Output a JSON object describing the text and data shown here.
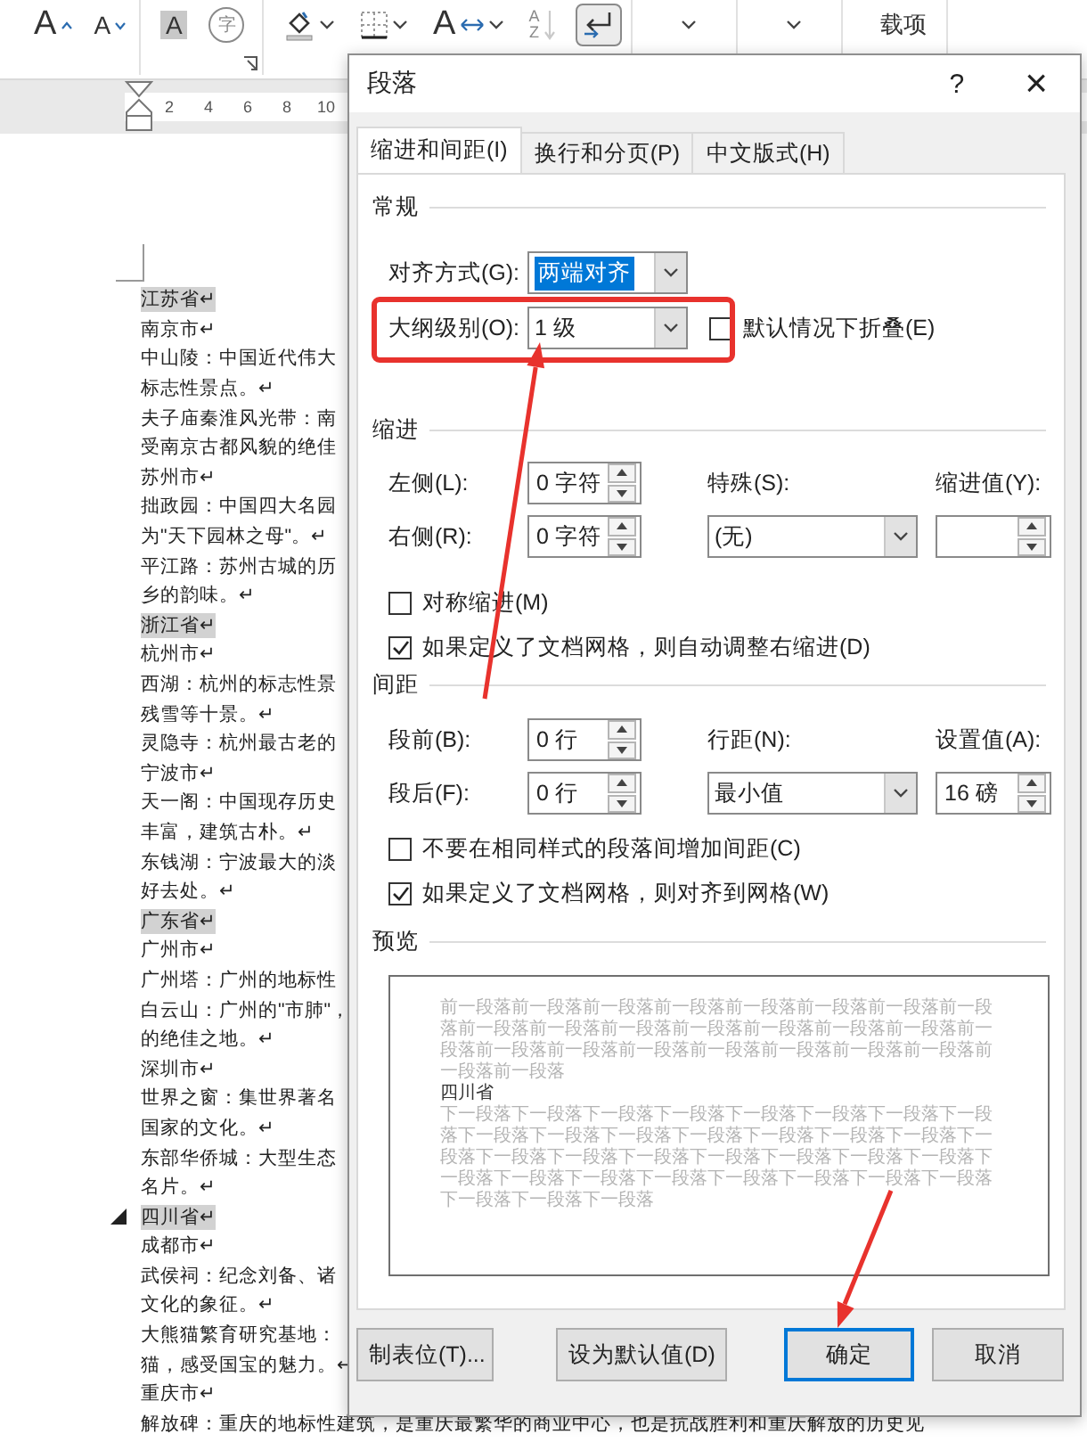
{
  "ribbon": {
    "groups": [
      [
        {
          "kind": "grow-font",
          "glyph": "A",
          "pressed": false,
          "disabled": false
        },
        {
          "kind": "shrink-font",
          "glyph": "A",
          "pressed": false,
          "disabled": false
        }
      ],
      [
        {
          "kind": "char-shading",
          "glyph": "A",
          "pressed": false,
          "disabled": false
        },
        {
          "kind": "enclose",
          "glyph": "字",
          "pressed": false,
          "disabled": true
        }
      ],
      [
        {
          "kind": "shading",
          "pressed": false,
          "disabled": false
        },
        {
          "kind": "borders",
          "pressed": false,
          "disabled": false
        },
        {
          "kind": "asian-layout",
          "glyph": "A",
          "pressed": false,
          "disabled": false
        },
        {
          "kind": "sort",
          "glyphs": [
            "A",
            "Z"
          ],
          "pressed": false,
          "disabled": true
        },
        {
          "kind": "show-marks",
          "pressed": true,
          "disabled": false
        }
      ],
      [
        {
          "kind": "dropdown",
          "pressed": false,
          "disabled": false
        }
      ],
      [
        {
          "kind": "dropdown",
          "pressed": false,
          "disabled": false
        }
      ],
      [
        {
          "kind": "label",
          "label": "载项",
          "pressed": false,
          "disabled": false
        }
      ]
    ]
  },
  "ruler": {
    "ticks": [
      "2",
      "4",
      "6",
      "8",
      "10"
    ]
  },
  "document": {
    "lines": [
      {
        "text": "江苏省↵",
        "heading": true,
        "toggle": false
      },
      {
        "text": "南京市↵",
        "heading": false,
        "toggle": false
      },
      {
        "text": "中山陵：中国近代伟大",
        "heading": false,
        "toggle": false
      },
      {
        "text": "标志性景点。↵",
        "heading": false,
        "toggle": false
      },
      {
        "text": "夫子庙秦淮风光带：南",
        "heading": false,
        "toggle": false
      },
      {
        "text": "受南京古都风貌的绝佳",
        "heading": false,
        "toggle": false
      },
      {
        "text": "苏州市↵",
        "heading": false,
        "toggle": false
      },
      {
        "text": "拙政园：中国四大名园",
        "heading": false,
        "toggle": false
      },
      {
        "text": "为\"天下园林之母\"。↵",
        "heading": false,
        "toggle": false
      },
      {
        "text": "平江路：苏州古城的历",
        "heading": false,
        "toggle": false
      },
      {
        "text": "乡的韵味。↵",
        "heading": false,
        "toggle": false
      },
      {
        "text": "浙江省↵",
        "heading": true,
        "toggle": false
      },
      {
        "text": "杭州市↵",
        "heading": false,
        "toggle": false
      },
      {
        "text": "西湖：杭州的标志性景",
        "heading": false,
        "toggle": false
      },
      {
        "text": "残雪等十景。↵",
        "heading": false,
        "toggle": false
      },
      {
        "text": "灵隐寺：杭州最古老的",
        "heading": false,
        "toggle": false
      },
      {
        "text": "宁波市↵",
        "heading": false,
        "toggle": false
      },
      {
        "text": "天一阁：中国现存历史",
        "heading": false,
        "toggle": false
      },
      {
        "text": "丰富，建筑古朴。↵",
        "heading": false,
        "toggle": false
      },
      {
        "text": "东钱湖：宁波最大的淡",
        "heading": false,
        "toggle": false
      },
      {
        "text": "好去处。↵",
        "heading": false,
        "toggle": false
      },
      {
        "text": "广东省↵",
        "heading": true,
        "toggle": false
      },
      {
        "text": "广州市↵",
        "heading": false,
        "toggle": false
      },
      {
        "text": "广州塔：广州的地标性",
        "heading": false,
        "toggle": false
      },
      {
        "text": "白云山：广州的\"市肺\"，",
        "heading": false,
        "toggle": false
      },
      {
        "text": "的绝佳之地。↵",
        "heading": false,
        "toggle": false
      },
      {
        "text": "深圳市↵",
        "heading": false,
        "toggle": false
      },
      {
        "text": "世界之窗：集世界著名",
        "heading": false,
        "toggle": false
      },
      {
        "text": "国家的文化。↵",
        "heading": false,
        "toggle": false
      },
      {
        "text": "东部华侨城：大型生态",
        "heading": false,
        "toggle": false
      },
      {
        "text": "名片。↵",
        "heading": false,
        "toggle": false
      },
      {
        "text": "四川省↵",
        "heading": true,
        "toggle": true
      },
      {
        "text": "成都市↵",
        "heading": false,
        "toggle": false
      },
      {
        "text": "武侯祠：纪念刘备、诸",
        "heading": false,
        "toggle": false
      },
      {
        "text": "文化的象征。↵",
        "heading": false,
        "toggle": false
      },
      {
        "text": "大熊猫繁育研究基地：",
        "heading": false,
        "toggle": false
      },
      {
        "text": "猫，感受国宝的魅力。↵",
        "heading": false,
        "toggle": false
      },
      {
        "text": "重庆市↵",
        "heading": false,
        "toggle": false
      },
      {
        "text": "解放碑：重庆的地标性建筑，是重庆最繁华的商业中心，也是抗战胜利和重庆解放的历史见",
        "heading": false,
        "toggle": false
      }
    ]
  },
  "dialog": {
    "title": "段落",
    "help": "?",
    "close": "×",
    "tabs": [
      {
        "label": "缩进和间距(I)",
        "selected": true
      },
      {
        "label": "换行和分页(P)",
        "selected": false
      },
      {
        "label": "中文版式(H)",
        "selected": false
      }
    ],
    "general": {
      "heading": "常规",
      "alignment": {
        "label": "对齐方式(G):",
        "value": "两端对齐",
        "highlighted": true
      },
      "outline_level": {
        "label": "大纲级别(O):",
        "value": "1 级",
        "highlighted": false
      },
      "collapse": {
        "label": "默认情况下折叠(E)",
        "checked": false
      }
    },
    "indent": {
      "heading": "缩进",
      "left": {
        "label": "左侧(L):",
        "value": "0 字符"
      },
      "right": {
        "label": "右侧(R):",
        "value": "0 字符"
      },
      "special": {
        "label": "特殊(S):",
        "value": "(无)"
      },
      "by": {
        "label": "缩进值(Y):"
      },
      "mirror": {
        "label": "对称缩进(M)",
        "checked": false
      },
      "auto_adjust": {
        "label": "如果定义了文档网格，则自动调整右缩进(D)",
        "checked": true
      }
    },
    "spacing": {
      "heading": "间距",
      "before": {
        "label": "段前(B):",
        "value": "0 行"
      },
      "after": {
        "label": "段后(F):",
        "value": "0 行"
      },
      "line_spacing": {
        "label": "行距(N):",
        "value": "最小值"
      },
      "at": {
        "label": "设置值(A):",
        "value": "16 磅"
      },
      "no_space": {
        "label": "不要在相同样式的段落间增加间距(C)",
        "checked": false
      },
      "snap": {
        "label": "如果定义了文档网格，则对齐到网格(W)",
        "checked": true
      }
    },
    "preview": {
      "heading": "预览",
      "before_text": "前一段落前一段落前一段落前一段落前一段落前一段落前一段落前一段落前一段落前一段落前一段落前一段落前一段落前一段落前一段落前一段落前一段落前一段落前一段落前一段落前一段落前一段落前一段落前一段落前一段落",
      "current_text": "四川省",
      "after_text": "下一段落下一段落下一段落下一段落下一段落下一段落下一段落下一段落下一段落下一段落下一段落下一段落下一段落下一段落下一段落下一段落下一段落下一段落下一段落下一段落下一段落下一段落下一段落下一段落下一段落下一段落下一段落下一段落下一段落下一段落下一段落下一段落下一段落下一段落"
    },
    "buttons": [
      {
        "label": "制表位(T)...",
        "default": false
      },
      {
        "label": "设为默认值(D)",
        "default": false
      },
      {
        "label": "确定",
        "default": true
      },
      {
        "label": "取消",
        "default": false
      }
    ]
  }
}
